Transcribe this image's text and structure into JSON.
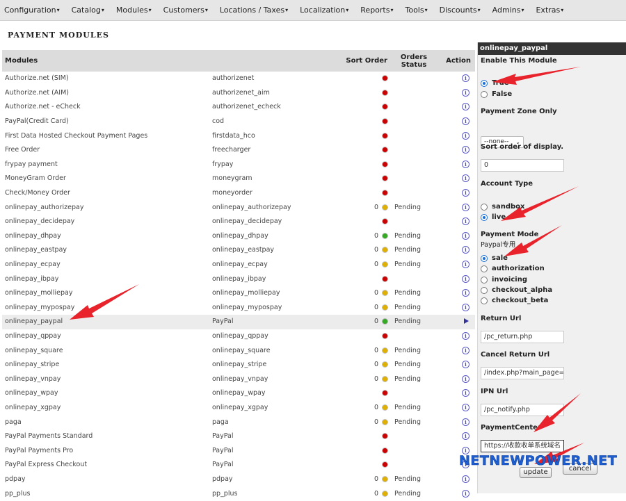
{
  "menu": [
    {
      "label": "Configuration"
    },
    {
      "label": "Catalog"
    },
    {
      "label": "Modules"
    },
    {
      "label": "Customers"
    },
    {
      "label": "Locations / Taxes"
    },
    {
      "label": "Localization"
    },
    {
      "label": "Reports"
    },
    {
      "label": "Tools"
    },
    {
      "label": "Discounts"
    },
    {
      "label": "Admins"
    },
    {
      "label": "Extras"
    }
  ],
  "page_title": "Payment Modules",
  "table": {
    "headers": {
      "modules": "Modules",
      "sort_order": "Sort Order",
      "orders_status": "Orders Status",
      "action": "Action"
    },
    "rows": [
      {
        "name": "Authorize.net (SIM)",
        "code": "authorizenet",
        "sort": "",
        "status_color": "#cc0000",
        "orders_status": "",
        "action": "info"
      },
      {
        "name": "Authorize.net (AIM)",
        "code": "authorizenet_aim",
        "sort": "",
        "status_color": "#cc0000",
        "orders_status": "",
        "action": "info"
      },
      {
        "name": "Authorize.net - eCheck",
        "code": "authorizenet_echeck",
        "sort": "",
        "status_color": "#cc0000",
        "orders_status": "",
        "action": "info"
      },
      {
        "name": "PayPal(Credit Card)",
        "code": "cod",
        "sort": "",
        "status_color": "#cc0000",
        "orders_status": "",
        "action": "info"
      },
      {
        "name": "First Data Hosted Checkout Payment Pages",
        "code": "firstdata_hco",
        "sort": "",
        "status_color": "#cc0000",
        "orders_status": "",
        "action": "info"
      },
      {
        "name": "Free Order",
        "code": "freecharger",
        "sort": "",
        "status_color": "#cc0000",
        "orders_status": "",
        "action": "info"
      },
      {
        "name": "frypay payment",
        "code": "frypay",
        "sort": "",
        "status_color": "#cc0000",
        "orders_status": "",
        "action": "info"
      },
      {
        "name": "MoneyGram Order",
        "code": "moneygram",
        "sort": "",
        "status_color": "#cc0000",
        "orders_status": "",
        "action": "info"
      },
      {
        "name": "Check/Money Order",
        "code": "moneyorder",
        "sort": "",
        "status_color": "#cc0000",
        "orders_status": "",
        "action": "info"
      },
      {
        "name": "onlinepay_authorizepay",
        "code": "onlinepay_authorizepay",
        "sort": "0",
        "status_color": "#e0b000",
        "orders_status": "Pending",
        "action": "info"
      },
      {
        "name": "onlinepay_decidepay",
        "code": "onlinepay_decidepay",
        "sort": "",
        "status_color": "#cc0000",
        "orders_status": "",
        "action": "info"
      },
      {
        "name": "onlinepay_dhpay",
        "code": "onlinepay_dhpay",
        "sort": "0",
        "status_color": "#33aa22",
        "orders_status": "Pending",
        "action": "info"
      },
      {
        "name": "onlinepay_eastpay",
        "code": "onlinepay_eastpay",
        "sort": "0",
        "status_color": "#e0b000",
        "orders_status": "Pending",
        "action": "info"
      },
      {
        "name": "onlinepay_ecpay",
        "code": "onlinepay_ecpay",
        "sort": "0",
        "status_color": "#e0b000",
        "orders_status": "Pending",
        "action": "info"
      },
      {
        "name": "onlinepay_ibpay",
        "code": "onlinepay_ibpay",
        "sort": "",
        "status_color": "#cc0000",
        "orders_status": "",
        "action": "info"
      },
      {
        "name": "onlinepay_molliepay",
        "code": "onlinepay_molliepay",
        "sort": "0",
        "status_color": "#e0b000",
        "orders_status": "Pending",
        "action": "info"
      },
      {
        "name": "onlinepay_mypospay",
        "code": "onlinepay_mypospay",
        "sort": "0",
        "status_color": "#e0b000",
        "orders_status": "Pending",
        "action": "info"
      },
      {
        "name": "onlinepay_paypal",
        "code": "PayPal",
        "sort": "0",
        "status_color": "#33aa22",
        "orders_status": "Pending",
        "action": "arrow",
        "selected": true
      },
      {
        "name": "onlinepay_qppay",
        "code": "onlinepay_qppay",
        "sort": "",
        "status_color": "#cc0000",
        "orders_status": "",
        "action": "info"
      },
      {
        "name": "onlinepay_square",
        "code": "onlinepay_square",
        "sort": "0",
        "status_color": "#e0b000",
        "orders_status": "Pending",
        "action": "info"
      },
      {
        "name": "onlinepay_stripe",
        "code": "onlinepay_stripe",
        "sort": "0",
        "status_color": "#e0b000",
        "orders_status": "Pending",
        "action": "info"
      },
      {
        "name": "onlinepay_vnpay",
        "code": "onlinepay_vnpay",
        "sort": "0",
        "status_color": "#e0b000",
        "orders_status": "Pending",
        "action": "info"
      },
      {
        "name": "onlinepay_wpay",
        "code": "onlinepay_wpay",
        "sort": "",
        "status_color": "#cc0000",
        "orders_status": "",
        "action": "info"
      },
      {
        "name": "onlinepay_xgpay",
        "code": "onlinepay_xgpay",
        "sort": "0",
        "status_color": "#e0b000",
        "orders_status": "Pending",
        "action": "info"
      },
      {
        "name": "paga",
        "code": "paga",
        "sort": "0",
        "status_color": "#e0b000",
        "orders_status": "Pending",
        "action": "info"
      },
      {
        "name": "PayPal Payments Standard",
        "code": "PayPal",
        "sort": "",
        "status_color": "#cc0000",
        "orders_status": "",
        "action": "info"
      },
      {
        "name": "PayPal Payments Pro",
        "code": "PayPal",
        "sort": "",
        "status_color": "#cc0000",
        "orders_status": "",
        "action": "info"
      },
      {
        "name": "PayPal Express Checkout",
        "code": "PayPal",
        "sort": "",
        "status_color": "#cc0000",
        "orders_status": "",
        "action": "info"
      },
      {
        "name": "pdpay",
        "code": "pdpay",
        "sort": "0",
        "status_color": "#e0b000",
        "orders_status": "Pending",
        "action": "info"
      },
      {
        "name": "pp_plus",
        "code": "pp_plus",
        "sort": "0",
        "status_color": "#e0b000",
        "orders_status": "Pending",
        "action": "info"
      }
    ]
  },
  "panel": {
    "header": "onlinepay_paypal",
    "enable_label": "Enable This Module",
    "enable_true": "True",
    "enable_false": "False",
    "zone_label": "Payment Zone Only",
    "zone_value": "--none--",
    "sort_label": "Sort order of display.",
    "sort_value": "0",
    "account_label": "Account Type",
    "account_sandbox": "sandbox",
    "account_live": "live",
    "mode_label": "Payment Mode",
    "mode_sub": "Paypal专用",
    "mode_sale": "sale",
    "mode_authorization": "authorization",
    "mode_invoicing": "invoicing",
    "mode_checkout_alpha": "checkout_alpha",
    "mode_checkout_beta": "checkout_beta",
    "return_label": "Return Url",
    "return_value": "/pc_return.php",
    "cancel_label": "Cancel Return Url",
    "cancel_value": "/index.php?main_page=s",
    "ipn_label": "IPN Url",
    "ipn_value": "/pc_notify.php",
    "center_label": "PaymentCenter",
    "center_value": "https://收款收单系统域名",
    "update_button": "update",
    "cancel_button": "cancel"
  },
  "watermark": "NETNEWPOWER.NET",
  "colors": {
    "annotation_arrow": "#e8232b",
    "header_bg": "#dcdcdc",
    "menu_bg": "#e6e6e6"
  }
}
